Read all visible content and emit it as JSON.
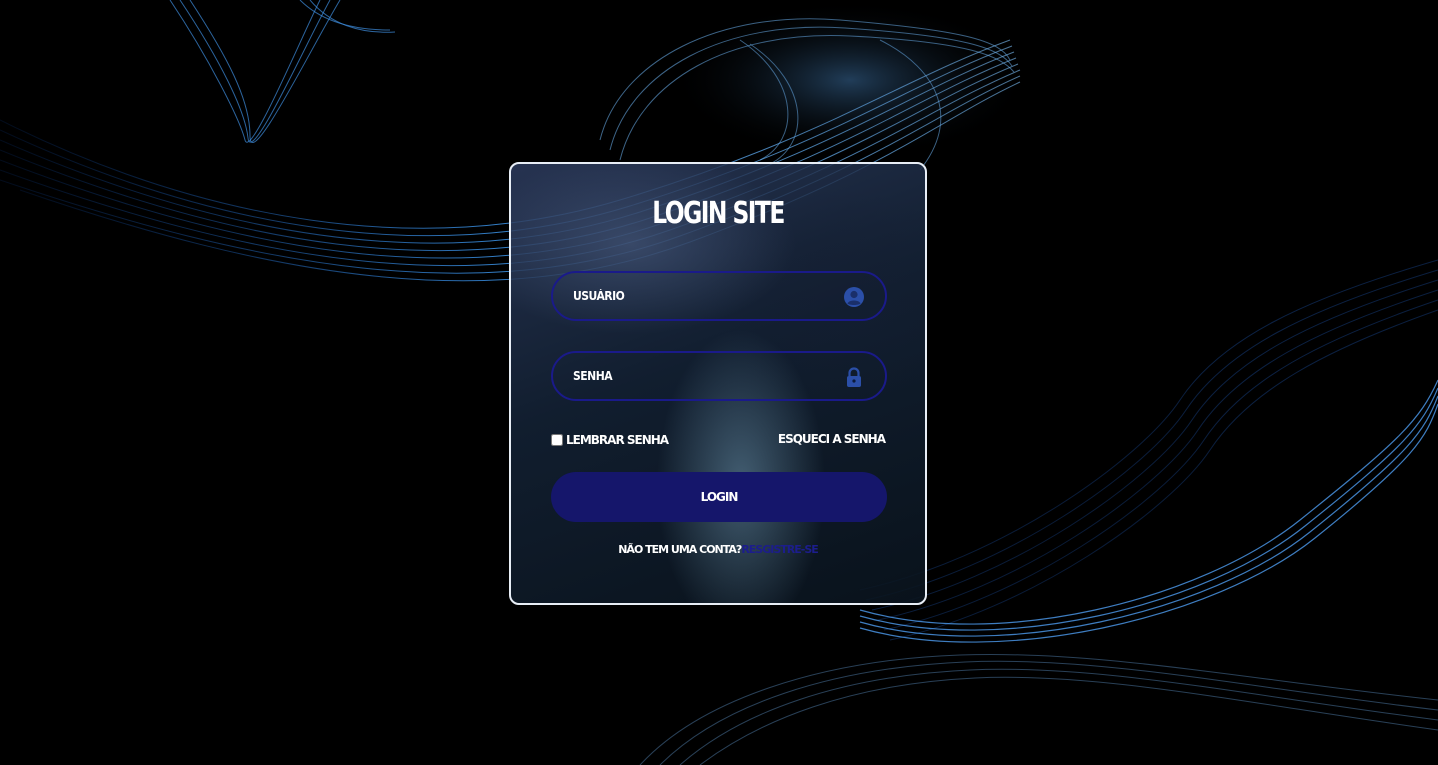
{
  "login": {
    "title": "LOGIN SITE",
    "username_placeholder": "USUÁRIO",
    "password_placeholder": "SENHA",
    "remember_label": "LEMBRAR SENHA",
    "forgot_label": "ESQUECI A SENHA",
    "login_button": "LOGIN",
    "no_account_text": "NÃO TEM UMA CONTA?",
    "register_link": "RESGISTRE-SE"
  },
  "icons": {
    "username": "user-circle-icon",
    "password": "lock-icon"
  },
  "colors": {
    "accent": "#15166b",
    "field_border": "#1a1a8a",
    "icon": "#2b4fa8",
    "link": "#1c1d8c",
    "text": "#ffffff",
    "background": "#000000"
  }
}
